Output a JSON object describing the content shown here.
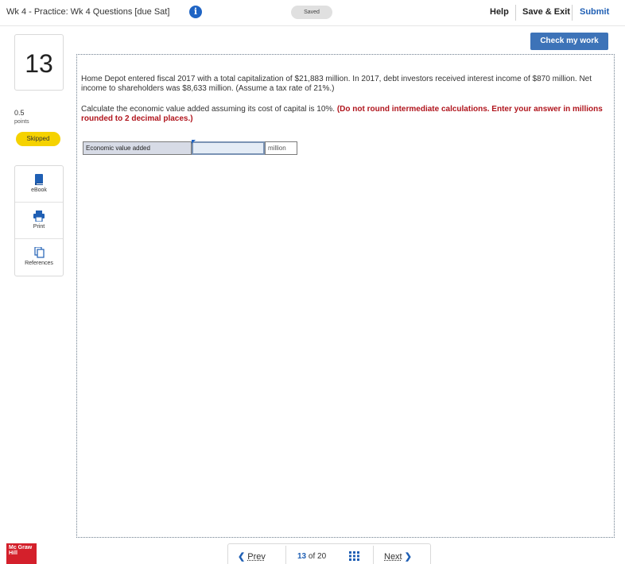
{
  "header": {
    "title": "Wk 4 - Practice: Wk 4 Questions [due Sat]",
    "info_glyph": "i",
    "saved_label": "Saved",
    "help_label": "Help",
    "save_exit_label": "Save & Exit",
    "submit_label": "Submit"
  },
  "question": {
    "number": "13",
    "points_value": "0.5",
    "points_label": "points",
    "status": "Skipped",
    "body": "Home Depot entered fiscal 2017 with a total capitalization of $21,883 million. In 2017, debt investors received interest income of $870 million. Net income to shareholders was $8,633 million. (Assume a tax rate of 21%.)",
    "instruction": "Calculate the economic value added assuming its cost of capital is 10%.",
    "instruction_red": "(Do not round intermediate calculations. Enter your answer in millions rounded to 2 decimal places.)",
    "answer_label": "Economic value added",
    "answer_value": "",
    "answer_unit": "million"
  },
  "tools": [
    {
      "label": "eBook",
      "icon": "book-icon"
    },
    {
      "label": "Print",
      "icon": "printer-icon"
    },
    {
      "label": "References",
      "icon": "references-icon"
    }
  ],
  "actions": {
    "check_label": "Check my work"
  },
  "footer": {
    "logo_text": "Mc Graw Hill",
    "prev_label": "Prev",
    "current_page": "13",
    "of_label": "of",
    "total_pages": "20",
    "next_label": "Next"
  },
  "colors": {
    "accent_blue": "#1f5fb4",
    "button_blue": "#3d73b8",
    "skipped_yellow": "#f5d200",
    "instruction_red": "#b0151d",
    "brand_red": "#d4202b"
  }
}
